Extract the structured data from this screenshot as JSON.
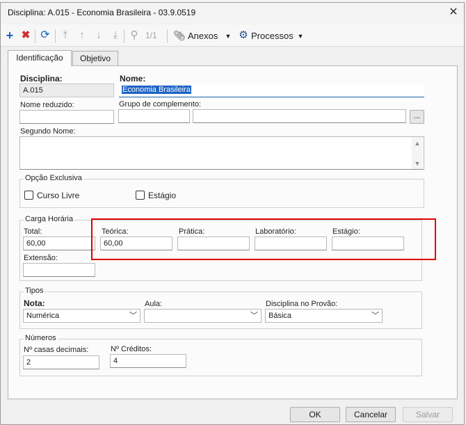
{
  "background": {
    "text": "disciplina"
  },
  "window": {
    "title": "Disciplina: A.015 - Economia Brasileira - 03.9.0519",
    "close_glyph": "✕"
  },
  "toolbar": {
    "page_indicator": "1/1",
    "anexos_label": "Anexos",
    "processos_label": "Processos",
    "colors": {
      "add": "#1565c0",
      "delete": "#d32f2f",
      "refresh": "#1565c0"
    }
  },
  "tabs": [
    {
      "label": "Identificação",
      "active": true
    },
    {
      "label": "Objetivo",
      "active": false
    }
  ],
  "fields": {
    "disciplina_label": "Disciplina:",
    "disciplina_value": "A.015",
    "nome_label": "Nome:",
    "nome_value": "Economia Brasileira",
    "nome_reduzido_label": "Nome reduzido:",
    "nome_reduzido_value": "",
    "grupo_label": "Grupo de complemento:",
    "grupo_value_1": "",
    "grupo_value_2": "",
    "grupo_button": "...",
    "segundo_nome_label": "Segundo Nome:",
    "segundo_nome_value": ""
  },
  "opcao_exclusiva": {
    "title": "Opção Exclusiva",
    "curso_livre": {
      "label": "Curso Livre",
      "checked": false
    },
    "estagio": {
      "label": "Estágio",
      "checked": false
    }
  },
  "carga_horaria": {
    "title": "Carga Horária",
    "total": {
      "label": "Total:",
      "value": "60,00"
    },
    "teorica": {
      "label": "Teórica:",
      "value": "60,00"
    },
    "pratica": {
      "label": "Prática:",
      "value": ""
    },
    "laboratorio": {
      "label": "Laboratório:",
      "value": ""
    },
    "estagio": {
      "label": "Estágio:",
      "value": ""
    },
    "extensao": {
      "label": "Extensão:",
      "value": ""
    }
  },
  "tipos": {
    "title": "Tipos",
    "nota": {
      "label": "Nota:",
      "value": "Numérica"
    },
    "aula": {
      "label": "Aula:",
      "value": ""
    },
    "disciplina_provao": {
      "label": "Disciplina no Provão:",
      "value": "Básica"
    }
  },
  "numeros": {
    "title": "Números",
    "casas_decimais": {
      "label": "Nº casas decimais:",
      "value": "2"
    },
    "creditos": {
      "label": "Nº Créditos:",
      "value": "4"
    }
  },
  "footer": {
    "ok_label": "OK",
    "cancelar_label": "Cancelar",
    "salvar_label": "Salvar"
  },
  "highlight_color": "#e00000"
}
